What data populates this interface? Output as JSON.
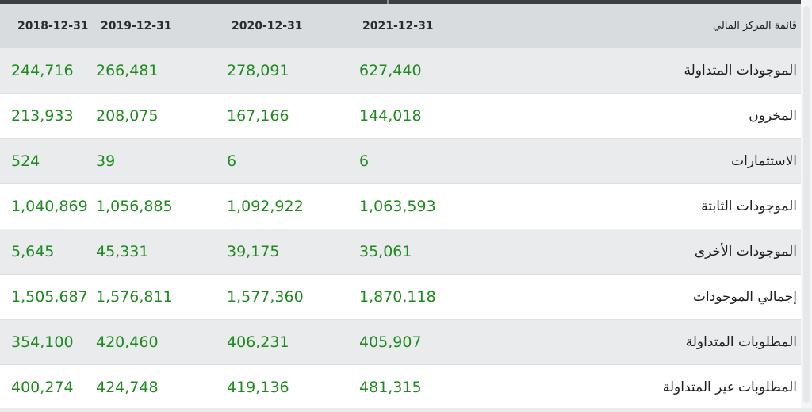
{
  "table": {
    "header": {
      "label": "قائمة المركز المالي",
      "years": [
        "2021-12-31",
        "2020-12-31",
        "2019-12-31",
        "2018-12-31"
      ]
    },
    "rows": [
      {
        "label": "الموجودات المتداولة",
        "values": [
          "627,440",
          "278,091",
          "266,481",
          "244,716"
        ]
      },
      {
        "label": "المخزون",
        "values": [
          "144,018",
          "167,166",
          "208,075",
          "213,933"
        ]
      },
      {
        "label": "الاستثمارات",
        "values": [
          "6",
          "6",
          "39",
          "524"
        ]
      },
      {
        "label": "الموجودات الثابتة",
        "values": [
          "1,063,593",
          "1,092,922",
          "1,056,885",
          "1,040,869"
        ]
      },
      {
        "label": "الموجودات الأخرى",
        "values": [
          "35,061",
          "39,175",
          "45,331",
          "5,645"
        ]
      },
      {
        "label": "إجمالي الموجودات",
        "values": [
          "1,870,118",
          "1,577,360",
          "1,576,811",
          "1,505,687"
        ]
      },
      {
        "label": "المطلوبات المتداولة",
        "values": [
          "405,907",
          "406,231",
          "420,460",
          "354,100"
        ]
      },
      {
        "label": "المطلوبات غير المتداولة",
        "values": [
          "481,315",
          "419,136",
          "424,748",
          "400,274"
        ]
      }
    ]
  },
  "colors": {
    "value_text": "#1f8a1f",
    "header_bg": "#d8dcdf",
    "shaded_row_bg": "#e9ebed"
  }
}
